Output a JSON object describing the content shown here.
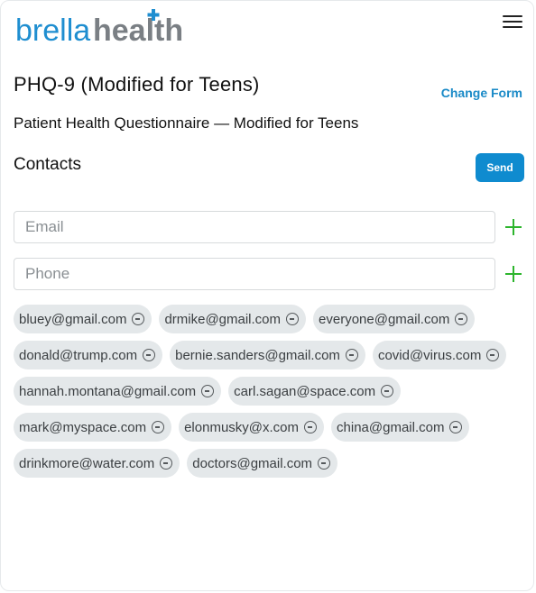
{
  "brand": {
    "name_part1": "brella",
    "name_part2": "health",
    "logo_color_light": "#1f8ed0",
    "logo_color_dark": "#7a7f84",
    "accent": "#1a8ac7"
  },
  "header": {
    "menu_icon": "hamburger-icon"
  },
  "form": {
    "title": "PHQ-9 (Modified for Teens)",
    "subtitle": "Patient Health Questionnaire — Modified for Teens",
    "change_label": "Change Form"
  },
  "contacts": {
    "heading": "Contacts",
    "send_label": "Send",
    "email_placeholder": "Email",
    "phone_placeholder": "Phone",
    "add_icon": "plus-icon",
    "remove_icon": "minus-circle-icon",
    "items": [
      "bluey@gmail.com",
      "drmike@gmail.com",
      "everyone@gmail.com",
      "donald@trump.com",
      "bernie.sanders@gmail.com",
      "covid@virus.com",
      "hannah.montana@gmail.com",
      "carl.sagan@space.com",
      "mark@myspace.com",
      "elonmusky@x.com",
      "china@gmail.com",
      "drinkmore@water.com",
      "doctors@gmail.com"
    ]
  }
}
